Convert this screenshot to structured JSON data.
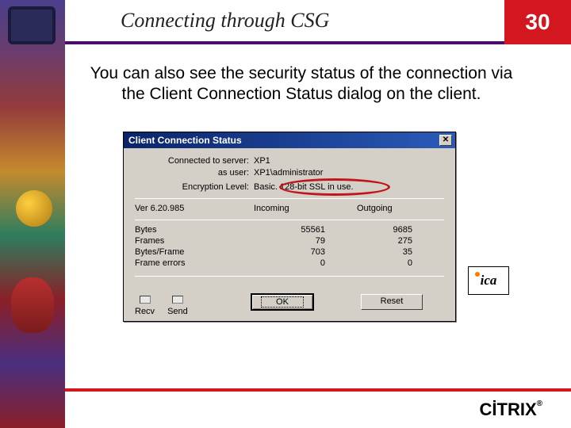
{
  "header": {
    "title": "Connecting through CSG",
    "slide_number": "30"
  },
  "body_text": "You can also see the security status of the connection via the Client Connection Status dialog on the client.",
  "dialog": {
    "title": "Client Connection Status",
    "close_glyph": "✕",
    "labels": {
      "connected_to_server": "Connected to server:",
      "as_user": "as user:",
      "encryption_level": "Encryption Level:"
    },
    "values": {
      "server": "XP1",
      "user": "XP1\\administrator",
      "encryption": "Basic. 128-bit SSL in use."
    },
    "version": "Ver 6.20.985",
    "columns": {
      "incoming": "Incoming",
      "outgoing": "Outgoing"
    },
    "stats": [
      {
        "name": "Bytes",
        "incoming": "55561",
        "outgoing": "9685"
      },
      {
        "name": "Frames",
        "incoming": "79",
        "outgoing": "275"
      },
      {
        "name": "Bytes/Frame",
        "incoming": "703",
        "outgoing": "35"
      },
      {
        "name": "Frame errors",
        "incoming": "0",
        "outgoing": "0"
      }
    ],
    "indicators": {
      "recv": "Recv",
      "send": "Send"
    },
    "buttons": {
      "ok": "OK",
      "reset": "Reset"
    }
  },
  "badges": {
    "ica": "ica",
    "citrix": "CİTRIX",
    "reg": "®"
  }
}
